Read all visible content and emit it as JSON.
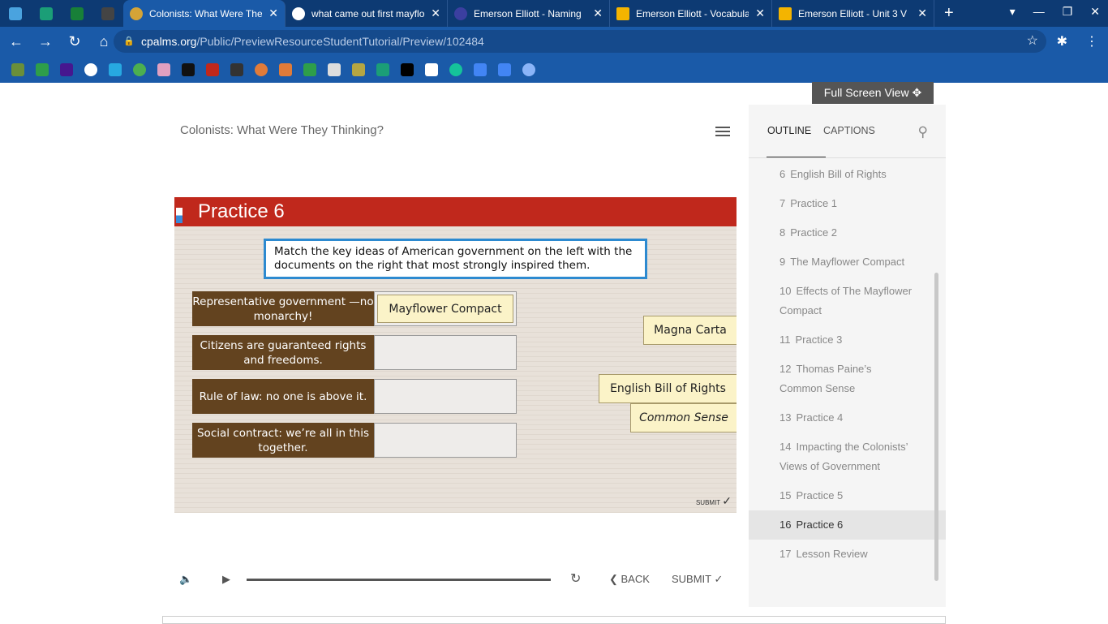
{
  "browser": {
    "tabs": [
      {
        "title": "Colonists: What Were They Thinking?",
        "active": true
      },
      {
        "title": "what came out first mayflower"
      },
      {
        "title": "Emerson Elliott - Naming"
      },
      {
        "title": "Emerson Elliott - Vocabulary"
      },
      {
        "title": "Emerson Elliott - Unit 3 V"
      }
    ],
    "url_domain": "cpalms.org",
    "url_path": "/Public/PreviewResourceStudentTutorial/Preview/102484"
  },
  "page": {
    "full_screen_label": "Full Screen View",
    "tutorial_title": "Colonists: What Were They Thinking?"
  },
  "slide": {
    "title": "Practice 6",
    "instructions": "Match the key ideas of American government on the left with the documents on the right that most strongly inspired them.",
    "ideas": [
      {
        "text": "Representative government —no monarchy!",
        "match": "Mayflower Compact"
      },
      {
        "text": "Citizens are guaranteed rights and freedoms.",
        "match": ""
      },
      {
        "text": "Rule of law: no one is above it.",
        "match": ""
      },
      {
        "text": "Social contract: we’re all in this together.",
        "match": ""
      }
    ],
    "cards": [
      "Magna Carta",
      "English Bill of Rights",
      "Common Sense"
    ],
    "submit_small": "SUBMIT"
  },
  "player": {
    "back_label": "BACK",
    "submit_label": "SUBMIT",
    "progress": 0
  },
  "sidebar": {
    "tabs": [
      "OUTLINE",
      "CAPTIONS"
    ],
    "items": [
      {
        "n": "6",
        "label": "English Bill of Rights"
      },
      {
        "n": "7",
        "label": "Practice 1"
      },
      {
        "n": "8",
        "label": "Practice 2"
      },
      {
        "n": "9",
        "label": "The Mayflower Compact"
      },
      {
        "n": "10",
        "label": "Effects of The Mayflower Compact"
      },
      {
        "n": "11",
        "label": "Practice 3"
      },
      {
        "n": "12",
        "label": "Thomas Paine’s Common Sense"
      },
      {
        "n": "13",
        "label": "Practice 4"
      },
      {
        "n": "14",
        "label": "Impacting the Colonists’ Views of Government"
      },
      {
        "n": "15",
        "label": "Practice 5"
      },
      {
        "n": "16",
        "label": "Practice 6"
      },
      {
        "n": "17",
        "label": "Lesson Review"
      }
    ]
  }
}
